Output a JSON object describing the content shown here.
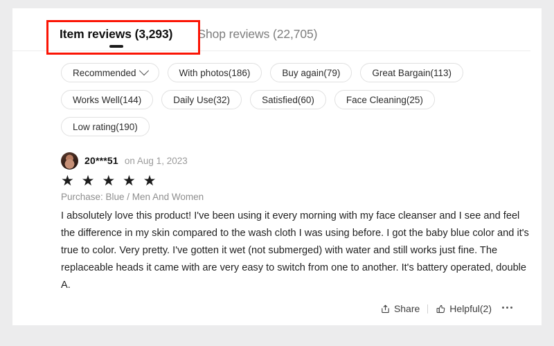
{
  "tabs": [
    {
      "label": "Item reviews (3,293)",
      "active": true
    },
    {
      "label": "Shop reviews (22,705)",
      "active": false
    }
  ],
  "filters": [
    {
      "label": "Recommended",
      "has_chevron": true
    },
    {
      "label": "With photos(186)",
      "has_chevron": false
    },
    {
      "label": "Buy again(79)",
      "has_chevron": false
    },
    {
      "label": "Great Bargain(113)",
      "has_chevron": false
    },
    {
      "label": "Works Well(144)",
      "has_chevron": false
    },
    {
      "label": "Daily Use(32)",
      "has_chevron": false
    },
    {
      "label": "Satisfied(60)",
      "has_chevron": false
    },
    {
      "label": "Face Cleaning(25)",
      "has_chevron": false
    },
    {
      "label": "Low rating(190)",
      "has_chevron": false
    }
  ],
  "review": {
    "reviewer": "20***51",
    "date": "on Aug 1, 2023",
    "rating": 5,
    "stars": "★ ★ ★ ★ ★",
    "purchase": "Purchase: Blue / Men And Women",
    "text": "I absolutely love this product! I've been using it every morning with my face cleanser and I see and feel the difference in my skin compared to the wash cloth I was using before. I got the baby blue color and it's true to color. Very pretty. I've gotten it wet (not submerged) with water and still works just fine. The replaceable heads it came with are very easy to switch from one to another. It's battery operated, double A."
  },
  "actions": {
    "share": "Share",
    "helpful": "Helpful(2)"
  },
  "colors": {
    "highlight": "#fb1404",
    "page_background": "#ececed",
    "card_background": "#ffffff",
    "active_tab_text": "#0f0f0f",
    "inactive_tab_text": "#7d7d7d",
    "muted_text": "#9b9b9b"
  }
}
